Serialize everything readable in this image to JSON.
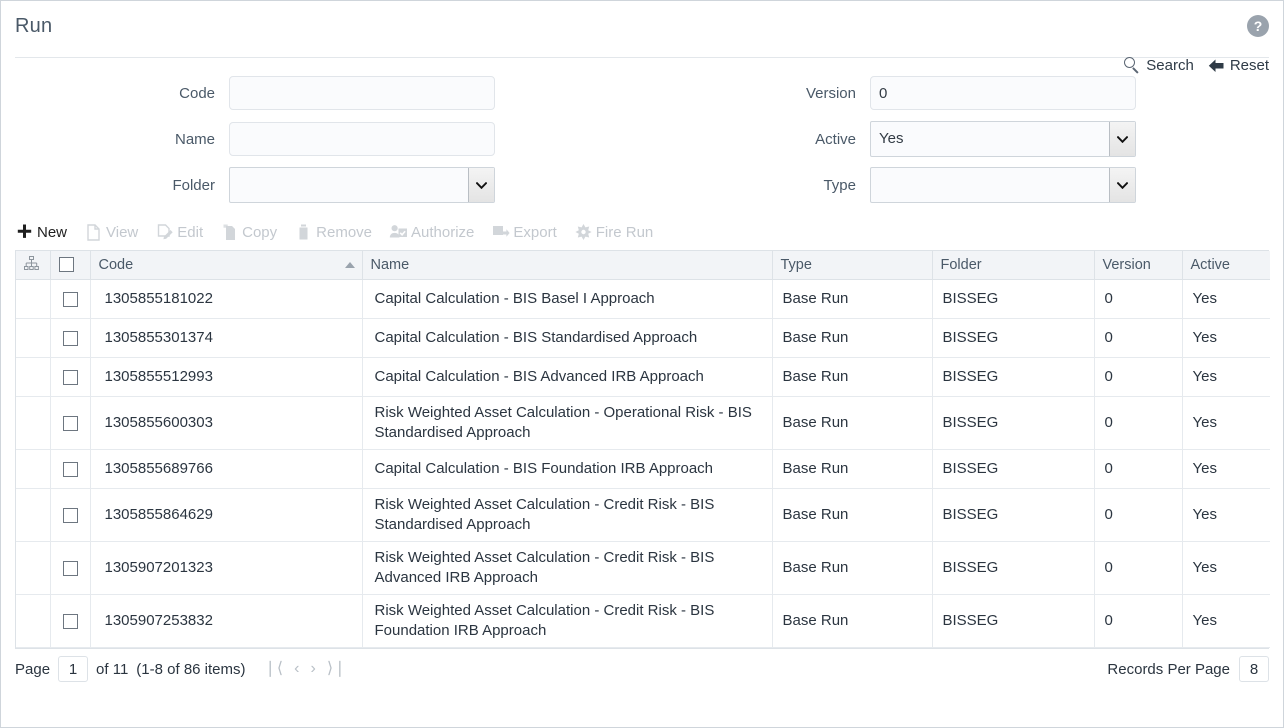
{
  "header": {
    "title": "Run",
    "help_icon": "help-circle-icon",
    "help_label": "?"
  },
  "searchbar": {
    "search_label": "Search",
    "search_icon": "magnifier-icon",
    "reset_label": "Reset",
    "reset_icon": "return-arrow-icon"
  },
  "filters": {
    "left": [
      {
        "label": "Code",
        "type": "text",
        "value": "",
        "placeholder": ""
      },
      {
        "label": "Name",
        "type": "text",
        "value": "",
        "placeholder": ""
      },
      {
        "label": "Folder",
        "type": "select",
        "value": ""
      }
    ],
    "right": [
      {
        "label": "Version",
        "type": "text",
        "value": "0",
        "placeholder": ""
      },
      {
        "label": "Active",
        "type": "select",
        "value": "Yes"
      },
      {
        "label": "Type",
        "type": "select",
        "value": ""
      }
    ]
  },
  "toolbar": [
    {
      "label": "New",
      "icon": "plus-icon",
      "enabled": true
    },
    {
      "label": "View",
      "icon": "document-icon",
      "enabled": false
    },
    {
      "label": "Edit",
      "icon": "pencil-doc-icon",
      "enabled": false
    },
    {
      "label": "Copy",
      "icon": "copy-icon",
      "enabled": false
    },
    {
      "label": "Remove",
      "icon": "trash-icon",
      "enabled": false
    },
    {
      "label": "Authorize",
      "icon": "user-check-icon",
      "enabled": false
    },
    {
      "label": "Export",
      "icon": "export-icon",
      "enabled": false
    },
    {
      "label": "Fire Run",
      "icon": "fire-run-icon",
      "enabled": false
    }
  ],
  "grid": {
    "columns": [
      {
        "key": "tree",
        "label": "",
        "icon": "hierarchy-icon"
      },
      {
        "key": "check",
        "label": "",
        "icon": "select-all-checkbox"
      },
      {
        "key": "code",
        "label": "Code",
        "sort": "asc"
      },
      {
        "key": "name",
        "label": "Name"
      },
      {
        "key": "type",
        "label": "Type"
      },
      {
        "key": "folder",
        "label": "Folder"
      },
      {
        "key": "ver",
        "label": "Version"
      },
      {
        "key": "act",
        "label": "Active"
      }
    ],
    "rows": [
      {
        "code": "1305855181022",
        "name": "Capital Calculation - BIS Basel I Approach",
        "type": "Base Run",
        "folder": "BISSEG",
        "version": "0",
        "active": "Yes",
        "tall": false
      },
      {
        "code": "1305855301374",
        "name": "Capital Calculation - BIS Standardised Approach",
        "type": "Base Run",
        "folder": "BISSEG",
        "version": "0",
        "active": "Yes",
        "tall": false
      },
      {
        "code": "1305855512993",
        "name": "Capital Calculation - BIS Advanced IRB Approach",
        "type": "Base Run",
        "folder": "BISSEG",
        "version": "0",
        "active": "Yes",
        "tall": false
      },
      {
        "code": "1305855600303",
        "name": "Risk Weighted Asset Calculation - Operational Risk - BIS Standardised Approach",
        "type": "Base Run",
        "folder": "BISSEG",
        "version": "0",
        "active": "Yes",
        "tall": true
      },
      {
        "code": "1305855689766",
        "name": "Capital Calculation - BIS Foundation IRB Approach",
        "type": "Base Run",
        "folder": "BISSEG",
        "version": "0",
        "active": "Yes",
        "tall": false
      },
      {
        "code": "1305855864629",
        "name": "Risk Weighted Asset Calculation - Credit Risk - BIS Standardised Approach",
        "type": "Base Run",
        "folder": "BISSEG",
        "version": "0",
        "active": "Yes",
        "tall": true
      },
      {
        "code": "1305907201323",
        "name": "Risk Weighted Asset Calculation - Credit Risk - BIS Advanced IRB Approach",
        "type": "Base Run",
        "folder": "BISSEG",
        "version": "0",
        "active": "Yes",
        "tall": true
      },
      {
        "code": "1305907253832",
        "name": "Risk Weighted Asset Calculation - Credit Risk - BIS Foundation IRB Approach",
        "type": "Base Run",
        "folder": "BISSEG",
        "version": "0",
        "active": "Yes",
        "tall": true
      }
    ]
  },
  "footer": {
    "page_word": "Page",
    "page_value": "1",
    "of_text": "of  11",
    "range_text": "(1-8 of  86 items)",
    "nav": {
      "first": "❘⟨",
      "prev": "‹",
      "next": "›",
      "last": "⟩❘"
    },
    "records_label": "Records Per Page",
    "records_value": "8"
  }
}
